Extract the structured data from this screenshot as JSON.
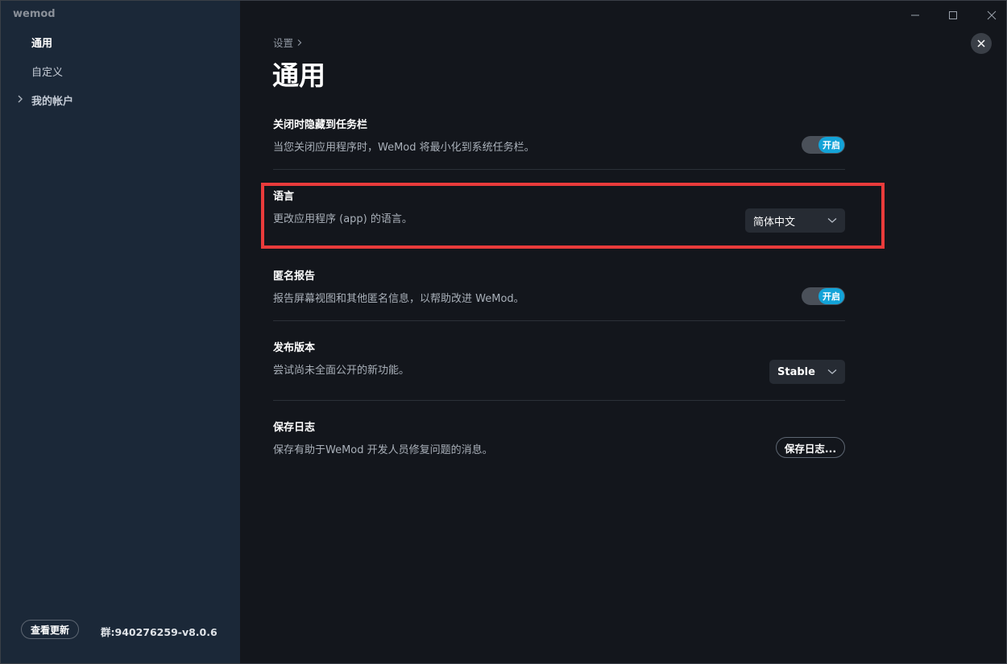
{
  "app": {
    "title": "wemod"
  },
  "sidebar": {
    "items": [
      {
        "label": "通用"
      },
      {
        "label": "自定义"
      },
      {
        "label": "我的帐户"
      }
    ],
    "update_button": "查看更新",
    "version": "群:940276259-v8.0.6"
  },
  "main": {
    "breadcrumb": "设置",
    "title": "通用",
    "settings": [
      {
        "title": "关闭时隐藏到任务栏",
        "description": "当您关闭应用程序时，WeMod 将最小化到系统任务栏。",
        "toggle_label": "开启"
      },
      {
        "title": "语言",
        "description": "更改应用程序 (app) 的语言。",
        "select_value": "简体中文"
      },
      {
        "title": "匿名报告",
        "description": "报告屏幕视图和其他匿名信息，以帮助改进 WeMod。",
        "toggle_label": "开启"
      },
      {
        "title": "发布版本",
        "description": "尝试尚未全面公开的新功能。",
        "select_value": "Stable"
      },
      {
        "title": "保存日志",
        "description": "保存有助于WeMod 开发人员修复问题的消息。",
        "button_label": "保存日志..."
      }
    ]
  },
  "colors": {
    "sidebar_bg": "#1b2838",
    "main_bg": "#13161c",
    "toggle_on": "#13a3d8",
    "highlight": "#e93b3b"
  },
  "icons": [
    "chevron-right-icon",
    "chevron-down-icon",
    "minimize-icon",
    "maximize-icon",
    "window-close-icon",
    "close-icon"
  ]
}
